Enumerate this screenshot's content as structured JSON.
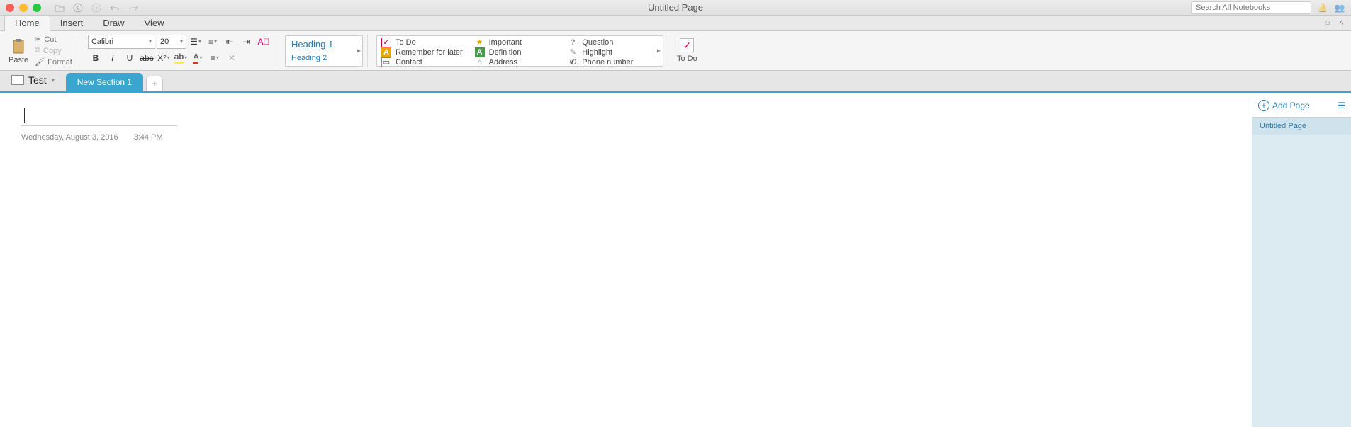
{
  "titlebar": {
    "title": "Untitled Page",
    "search_placeholder": "Search All Notebooks"
  },
  "ribbon_tabs": [
    "Home",
    "Insert",
    "Draw",
    "View"
  ],
  "clipboard": {
    "paste": "Paste",
    "cut": "Cut",
    "copy": "Copy",
    "format": "Format"
  },
  "font": {
    "name": "Calibri",
    "size": "20"
  },
  "styles": {
    "h1": "Heading 1",
    "h2": "Heading 2"
  },
  "tags": {
    "col1": [
      {
        "icon": "☐",
        "color": "#c03",
        "label": "To Do"
      },
      {
        "icon": "A",
        "color": "#e6a700",
        "label": "Remember for later"
      },
      {
        "icon": "▭",
        "color": "#888",
        "label": "Contact"
      }
    ],
    "col2": [
      {
        "icon": "★",
        "color": "#e6a700",
        "label": "Important"
      },
      {
        "icon": "A",
        "color": "#4a9b4a",
        "label": "Definition"
      },
      {
        "icon": "⌂",
        "color": "#888",
        "label": "Address"
      }
    ],
    "col3": [
      {
        "icon": "?",
        "color": "#888",
        "label": "Question"
      },
      {
        "icon": "✎",
        "color": "#888",
        "label": "Highlight"
      },
      {
        "icon": "✆",
        "color": "#333",
        "label": "Phone number"
      }
    ]
  },
  "todo_label": "To Do",
  "notebook": "Test",
  "section": "New Section 1",
  "page": {
    "date": "Wednesday, August 3, 2016",
    "time": "3:44 PM"
  },
  "pagelist": {
    "add": "Add Page",
    "items": [
      "Untitled Page"
    ]
  }
}
